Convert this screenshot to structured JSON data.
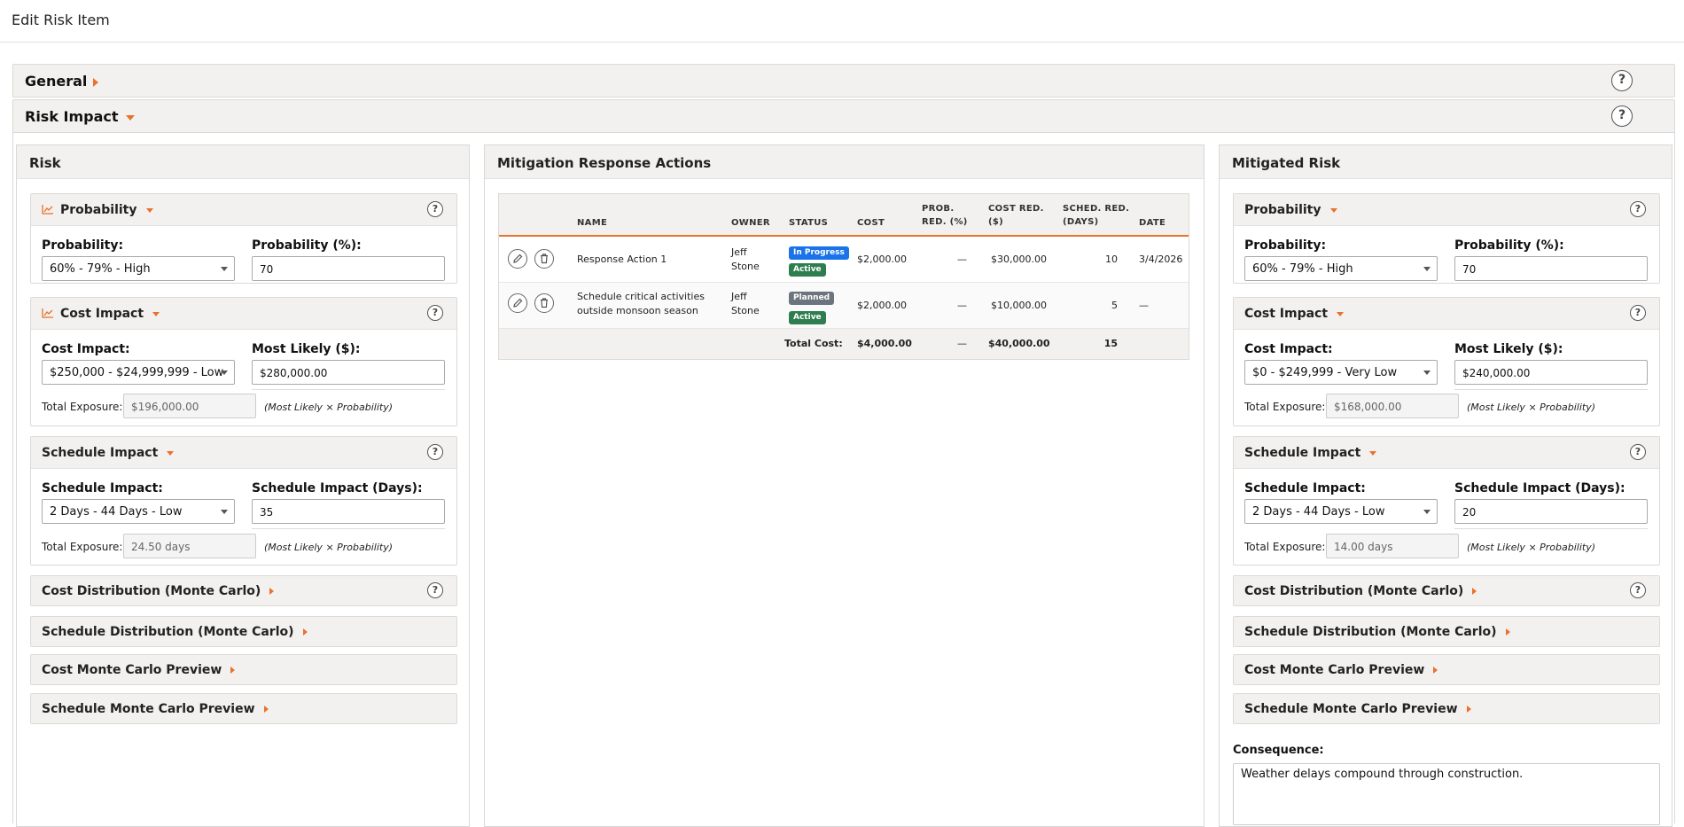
{
  "page": {
    "title": "Edit Risk Item"
  },
  "sections": {
    "general": "General",
    "risk_impact": "Risk Impact"
  },
  "risk": {
    "title": "Risk",
    "probability": {
      "header": "Probability",
      "label": "Probability:",
      "select": "60% - 79% - High",
      "pct_label": "Probability (%):",
      "pct": "70"
    },
    "cost": {
      "header": "Cost Impact",
      "label": "Cost Impact:",
      "select": "$250,000 - $24,999,999 - Low",
      "ml_label": "Most Likely ($):",
      "ml": "$280,000.00",
      "exp_label": "Total Exposure:",
      "exp": "$196,000.00",
      "note": "(Most Likely × Probability)"
    },
    "schedule": {
      "header": "Schedule Impact",
      "label": "Schedule Impact:",
      "select": "2 Days - 44 Days - Low",
      "days_label": "Schedule Impact (Days):",
      "days": "35",
      "exp_label": "Total Exposure:",
      "exp": "24.50 days",
      "note": "(Most Likely × Probability)"
    },
    "collapsed": [
      "Cost Distribution (Monte Carlo)",
      "Schedule Distribution (Monte Carlo)",
      "Cost Monte Carlo Preview",
      "Schedule Monte Carlo Preview"
    ]
  },
  "mitigation": {
    "title": "Mitigation Response Actions",
    "columns": {
      "name": "NAME",
      "owner": "OWNER",
      "status": "STATUS",
      "cost": "COST",
      "prob1": "PROB.",
      "prob2": "RED. (%)",
      "costred1": "COST RED.",
      "costred2": "($)",
      "sched1": "SCHED. RED.",
      "sched2": "(DAYS)",
      "date": "DATE"
    },
    "rows": [
      {
        "name1": "Response Action 1",
        "name2": "",
        "owner1": "Jeff",
        "owner2": "Stone",
        "status1": "In Progress",
        "status2": "Active",
        "cost": "$2,000.00",
        "prob": "—",
        "costred": "$30,000.00",
        "sched": "10",
        "date": "3/4/2026"
      },
      {
        "name1": "Schedule critical activities",
        "name2": "outside monsoon season",
        "owner1": "Jeff",
        "owner2": "Stone",
        "status1": "Planned",
        "status2": "Active",
        "cost": "$2,000.00",
        "prob": "—",
        "costred": "$10,000.00",
        "sched": "5",
        "date": "—"
      }
    ],
    "total": {
      "label": "Total Cost:",
      "cost": "$4,000.00",
      "prob": "—",
      "costred": "$40,000.00",
      "sched": "15"
    }
  },
  "mitigated": {
    "title": "Mitigated Risk",
    "probability": {
      "header": "Probability",
      "label": "Probability:",
      "select": "60% - 79% - High",
      "pct_label": "Probability (%):",
      "pct": "70"
    },
    "cost": {
      "header": "Cost Impact",
      "label": "Cost Impact:",
      "select": "$0 - $249,999 - Very Low",
      "ml_label": "Most Likely ($):",
      "ml": "$240,000.00",
      "exp_label": "Total Exposure:",
      "exp": "$168,000.00",
      "note": "(Most Likely × Probability)"
    },
    "schedule": {
      "header": "Schedule Impact",
      "label": "Schedule Impact:",
      "select": "2 Days - 44 Days - Low",
      "days_label": "Schedule Impact (Days):",
      "days": "20",
      "exp_label": "Total Exposure:",
      "exp": "14.00 days",
      "note": "(Most Likely × Probability)"
    },
    "collapsed": [
      "Cost Distribution (Monte Carlo)",
      "Schedule Distribution (Monte Carlo)",
      "Cost Monte Carlo Preview",
      "Schedule Monte Carlo Preview"
    ],
    "consequence_label": "Consequence:",
    "consequence": "Weather delays compound through construction."
  },
  "colors": {
    "accent": "#e8722c",
    "in_progress": "#1a73e8",
    "active": "#2e7d4f",
    "planned": "#6c757d"
  },
  "help_glyph": "?",
  "icons": {
    "chart": "chart-icon",
    "help": "help-icon",
    "edit": "pencil-icon",
    "delete": "trash-icon"
  }
}
